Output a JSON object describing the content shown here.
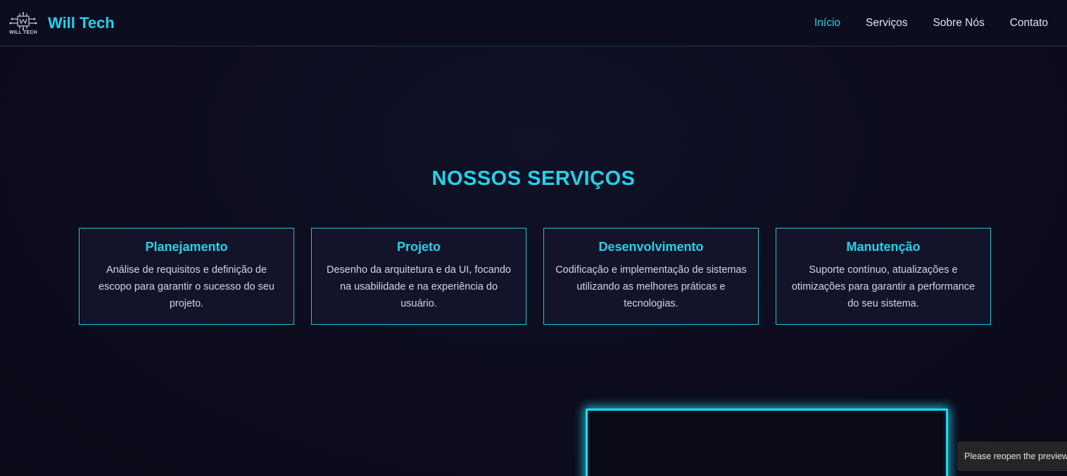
{
  "header": {
    "logo_text": "WILL TECH",
    "brand_name": "Will Tech",
    "nav": [
      {
        "label": "Início",
        "active": true
      },
      {
        "label": "Serviços",
        "active": false
      },
      {
        "label": "Sobre Nós",
        "active": false
      },
      {
        "label": "Contato",
        "active": false
      }
    ]
  },
  "services": {
    "title": "NOSSOS SERVIÇOS",
    "cards": [
      {
        "title": "Planejamento",
        "desc": "Análise de requisitos e definição de escopo para garantir o sucesso do seu projeto."
      },
      {
        "title": "Projeto",
        "desc": "Desenho da arquitetura e da UI, focando na usabilidade e na experiência do usuário."
      },
      {
        "title": "Desenvolvimento",
        "desc": "Codificação e implementação de sistemas utilizando as melhores práticas e tecnologias."
      },
      {
        "title": "Manutenção",
        "desc": "Suporte contínuo, atualizações e otimizações para garantir a performance do seu sistema."
      }
    ]
  },
  "toast": {
    "message": "Please reopen the preview."
  },
  "colors": {
    "accent": "#20d3ea",
    "background": "#0c0c1d",
    "card_bg": "#131429"
  }
}
